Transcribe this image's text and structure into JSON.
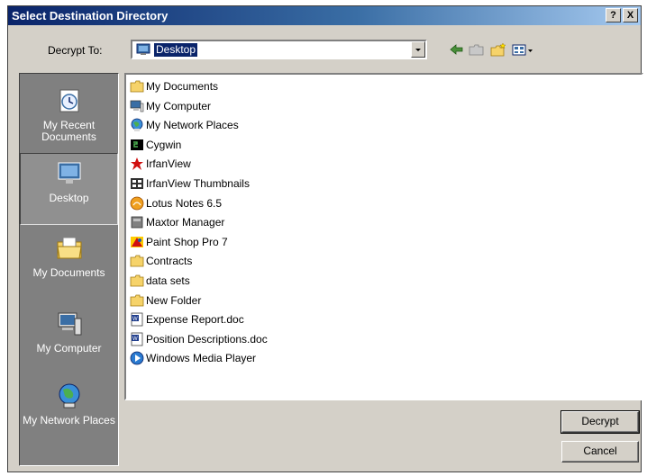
{
  "window": {
    "title": "Select Destination Directory",
    "help_label": "?",
    "close_label": "X"
  },
  "lookin": {
    "label": "Decrypt To:",
    "value": "Desktop"
  },
  "places": [
    {
      "label": "My Recent Documents",
      "icon": "recent-documents-icon"
    },
    {
      "label": "Desktop",
      "icon": "desktop-icon"
    },
    {
      "label": "My Documents",
      "icon": "my-documents-icon"
    },
    {
      "label": "My Computer",
      "icon": "my-computer-icon"
    },
    {
      "label": "My Network Places",
      "icon": "network-places-icon"
    }
  ],
  "files": [
    {
      "name": "My Documents",
      "icon": "folder"
    },
    {
      "name": "My Computer",
      "icon": "computer"
    },
    {
      "name": "My Network Places",
      "icon": "network"
    },
    {
      "name": "Cygwin",
      "icon": "cygwin"
    },
    {
      "name": "IrfanView",
      "icon": "irfan"
    },
    {
      "name": "IrfanView Thumbnails",
      "icon": "thumbs"
    },
    {
      "name": "Lotus Notes 6.5",
      "icon": "lotus"
    },
    {
      "name": "Maxtor Manager",
      "icon": "maxtor"
    },
    {
      "name": "Paint Shop Pro 7",
      "icon": "psp"
    },
    {
      "name": "Contracts",
      "icon": "folder"
    },
    {
      "name": "data sets",
      "icon": "folder"
    },
    {
      "name": "New Folder",
      "icon": "folder"
    },
    {
      "name": "Expense Report.doc",
      "icon": "doc"
    },
    {
      "name": "Position Descriptions.doc",
      "icon": "doc"
    },
    {
      "name": "Windows Media Player",
      "icon": "wmp"
    }
  ],
  "buttons": {
    "primary": "Decrypt",
    "cancel": "Cancel"
  }
}
